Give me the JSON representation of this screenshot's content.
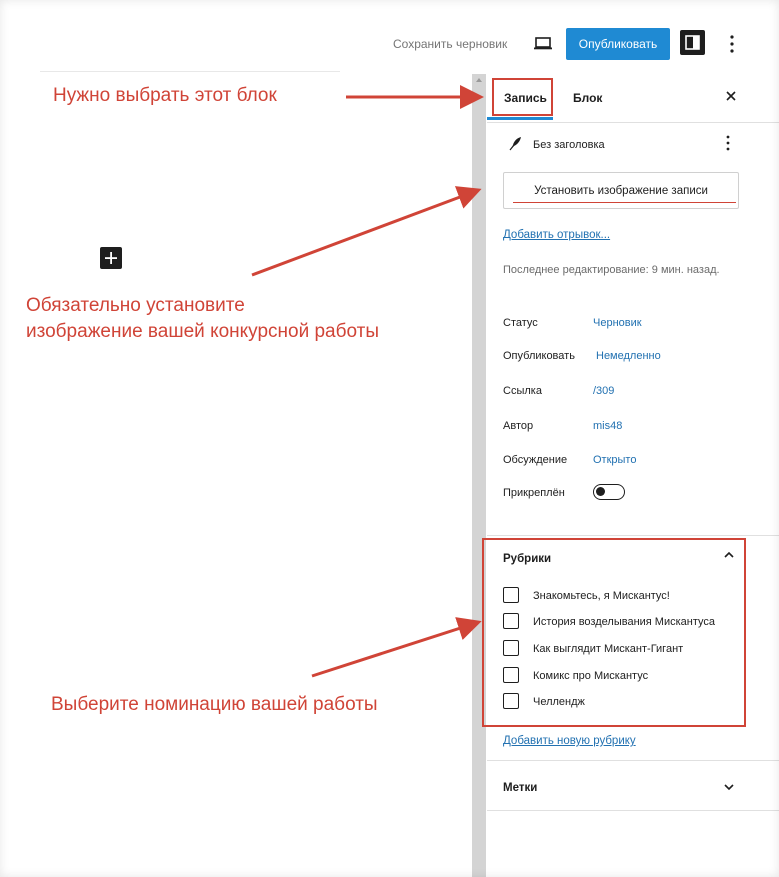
{
  "toolbar": {
    "save_draft": "Сохранить черновик",
    "publish": "Опубликовать",
    "icons": {
      "preview": "laptop-icon",
      "settings": "sidebar-toggle-icon",
      "more": "vertical-ellipsis-icon"
    },
    "accent_color": "#1f8ad3"
  },
  "canvas": {
    "add_block_icon": "plus-icon"
  },
  "sidebar": {
    "tabs": [
      {
        "label": "Запись",
        "active": true
      },
      {
        "label": "Блок",
        "active": false
      }
    ],
    "close_icon": "close-icon",
    "post": {
      "icon": "feather-icon",
      "title": "Без заголовка"
    },
    "featured_image_button": "Установить изображение записи",
    "add_excerpt": "Добавить отрывок...",
    "last_edited": "Последнее редактирование: 9 мин. назад.",
    "meta": [
      {
        "label": "Статус",
        "value": "Черновик"
      },
      {
        "label": "Опубликовать",
        "value": "Немедленно"
      },
      {
        "label": "Ссылка",
        "value": "/309"
      },
      {
        "label": "Автор",
        "value": "mis48"
      },
      {
        "label": "Обсуждение",
        "value": "Открыто"
      }
    ],
    "sticky_label": "Прикреплён",
    "sticky_on": false,
    "rubrics": {
      "title": "Рубрики",
      "expanded": true,
      "items": [
        {
          "label": "Знакомьтесь, я Мискантус!",
          "checked": false
        },
        {
          "label": "История возделывания Мискантуса",
          "checked": false
        },
        {
          "label": "Как выглядит Мискант-Гигант",
          "checked": false
        },
        {
          "label": "Комикс про Мискантус",
          "checked": false
        },
        {
          "label": "Челлендж",
          "checked": false
        }
      ],
      "add_new": "Добавить новую рубрику"
    },
    "tags": {
      "title": "Метки",
      "expanded": false
    }
  },
  "annotations": {
    "color": "#d04437",
    "choose_block": "Нужно выбрать этот блок",
    "set_image_line1": "Обязательно установите",
    "set_image_line2": "изображение вашей конкурсной работы",
    "choose_nomination": "Выберите номинацию вашей работы"
  }
}
